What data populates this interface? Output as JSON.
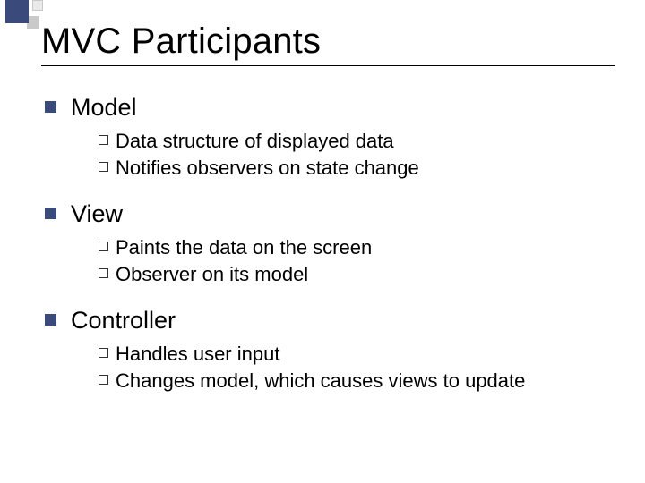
{
  "title": "MVC Participants",
  "sections": [
    {
      "heading": "Model",
      "items": [
        "Data structure of displayed data",
        "Notifies observers on state change"
      ]
    },
    {
      "heading": "View",
      "items": [
        "Paints the data on the screen",
        "Observer on its model"
      ]
    },
    {
      "heading": "Controller",
      "items": [
        "Handles user input",
        "Changes model, which causes views to update"
      ]
    }
  ]
}
